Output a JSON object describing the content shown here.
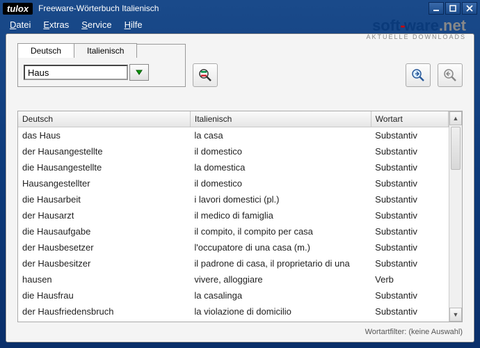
{
  "title": "Freeware-Wörterbuch Italienisch",
  "brand": "tulox",
  "menu": {
    "datei": "Datei",
    "extras": "Extras",
    "service": "Service",
    "hilfe": "Hilfe"
  },
  "watermark": {
    "soft": "soft",
    "ware": "ware",
    "dot": ".",
    "net": "net",
    "subtitle": "AKTUELLE DOWNLOADS"
  },
  "tabs": {
    "deutsch": "Deutsch",
    "italienisch": "Italienisch"
  },
  "search": {
    "value": "Haus"
  },
  "columns": {
    "de": "Deutsch",
    "it": "Italienisch",
    "wa": "Wortart"
  },
  "rows": [
    {
      "de": "das Haus",
      "it": "la casa",
      "wa": "Substantiv"
    },
    {
      "de": "der Hausangestellte",
      "it": "il domestico",
      "wa": "Substantiv"
    },
    {
      "de": "die Hausangestellte",
      "it": "la domestica",
      "wa": "Substantiv"
    },
    {
      "de": "Hausangestellter",
      "it": "il domestico",
      "wa": "Substantiv"
    },
    {
      "de": "die Hausarbeit",
      "it": "i lavori domestici (pl.)",
      "wa": "Substantiv"
    },
    {
      "de": "der Hausarzt",
      "it": "il medico di famiglia",
      "wa": "Substantiv"
    },
    {
      "de": "die Hausaufgabe",
      "it": "il compito, il compito per casa",
      "wa": "Substantiv"
    },
    {
      "de": "der Hausbesetzer",
      "it": "l'occupatore di una casa (m.)",
      "wa": "Substantiv"
    },
    {
      "de": "der Hausbesitzer",
      "it": "il padrone di casa, il proprietario di una",
      "wa": "Substantiv"
    },
    {
      "de": "hausen",
      "it": "vivere, alloggiare",
      "wa": "Verb"
    },
    {
      "de": "die Hausfrau",
      "it": "la casalinga",
      "wa": "Substantiv"
    },
    {
      "de": "der Hausfriedensbruch",
      "it": "la violazione di domicilio",
      "wa": "Substantiv"
    }
  ],
  "status": "Wortartfilter: (keine Auswahl)"
}
